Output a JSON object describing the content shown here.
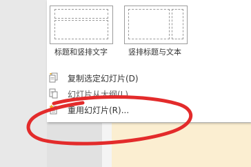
{
  "layouts": [
    {
      "label": "标题和竖排文字"
    },
    {
      "label": "竖排标题与文本"
    }
  ],
  "menu_items": [
    {
      "label": "复制选定幻灯片(D)",
      "icon": "duplicate-slide-icon"
    },
    {
      "label": "幻灯片从大纲(L)",
      "icon": "slides-from-outline-icon"
    },
    {
      "label": "重用幻灯片(R)...",
      "icon": "reuse-slides-icon"
    }
  ],
  "colors": {
    "annotation_red": "#e32b2b",
    "slide_background": "#fbeed1",
    "menu_background": "#ffffff"
  }
}
